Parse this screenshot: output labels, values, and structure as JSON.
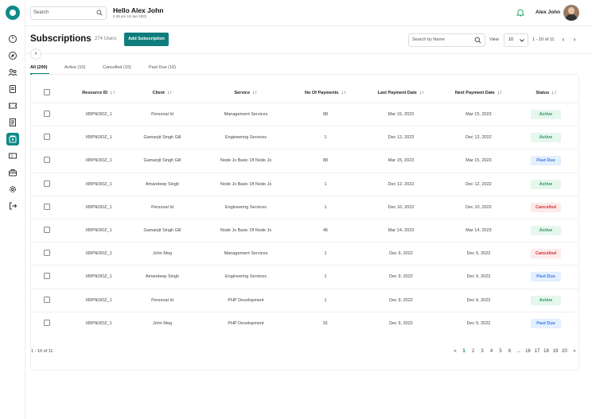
{
  "header": {
    "search_placeholder": "Search",
    "greeting": "Hello Alex John",
    "datetime": "4:45 pm 19 Jan 2022",
    "username": "Alex John"
  },
  "page": {
    "title": "Subscriptions",
    "user_count": "274 Users",
    "add_button": "Add Subscription",
    "search_placeholder": "Search by Name",
    "view_label": "View",
    "view_value": "10",
    "range": "1 - 10 of 11"
  },
  "tabs": [
    {
      "label": "All (200)"
    },
    {
      "label": "Active (10)"
    },
    {
      "label": "Cancelled (10)"
    },
    {
      "label": "Past Due (10)"
    }
  ],
  "columns": [
    "Resource ID",
    "Client",
    "Service",
    "No Of Payments",
    "Last Payment Date",
    "Next Payment Date",
    "Status"
  ],
  "rows": [
    {
      "id": "XBPNI3OZ_1",
      "client": "Personal Id",
      "service": "Management Services",
      "payments": "88",
      "last": "Mar 15, 2023",
      "next": "Mar 15, 2023",
      "status": "Active"
    },
    {
      "id": "XBPNI3OZ_1",
      "client": "Gamanjit Singh Gill",
      "service": "Engineering Services",
      "payments": "1",
      "last": "Dec 12, 2022",
      "next": "Dec 12, 2022",
      "status": "Active"
    },
    {
      "id": "XBPNI3OZ_1",
      "client": "Gamanjit Singh Gill",
      "service": "Node Js Basic Of Node Js",
      "payments": "88",
      "last": "Mar 15, 2023",
      "next": "Mar 15, 2023",
      "status": "Past Due"
    },
    {
      "id": "XBPNI3OZ_1",
      "client": "Amandeep Singh",
      "service": "Node Js Basic Of Node Js",
      "payments": "1",
      "last": "Dec 12, 2022",
      "next": "Dec 12, 2022",
      "status": "Active"
    },
    {
      "id": "XBPNI3OZ_1",
      "client": "Personal Id",
      "service": "Engineering Services",
      "payments": "1",
      "last": "Dec 10, 2022",
      "next": "Dec 10, 2022",
      "status": "Cancelled"
    },
    {
      "id": "XBPNI3OZ_1",
      "client": "Gamanjit Singh Gill",
      "service": "Node Js Basic Of Node Js",
      "payments": "46",
      "last": "Mar 14, 2023",
      "next": "Mar 14, 2023",
      "status": "Active"
    },
    {
      "id": "XBPNI3OZ_1",
      "client": "John Meg",
      "service": "Management Services",
      "payments": "1",
      "last": "Dec 9, 2022",
      "next": "Dec 9, 2022",
      "status": "Cancelled"
    },
    {
      "id": "XBPNI3OZ_1",
      "client": "Amandeep Singh",
      "service": "Engineering Services",
      "payments": "1",
      "last": "Dec 9, 2022",
      "next": "Dec 9, 2022",
      "status": "Past Due"
    },
    {
      "id": "XBPNI3OZ_1",
      "client": "Personal Id",
      "service": "PHP Development",
      "payments": "1",
      "last": "Dec 9, 2022",
      "next": "Dec 9, 2022",
      "status": "Active"
    },
    {
      "id": "XBPNI3OZ_1",
      "client": "John Meg",
      "service": "PHP Development",
      "payments": "91",
      "last": "Dec 9, 2022",
      "next": "Dec 9, 2022",
      "status": "Past Due"
    }
  ],
  "footer": {
    "range": "1 - 10 of 11",
    "pages": [
      "1",
      "2",
      "3",
      "4",
      "5",
      "6",
      "...",
      "16",
      "17",
      "18",
      "19",
      "20"
    ],
    "current_page": "1"
  },
  "colors": {
    "accent": "#0f7d7d",
    "active": "#1f9d55",
    "past_due": "#3c7ee8",
    "cancelled": "#d03232"
  },
  "icons": {
    "sidebar": [
      "dashboard-icon",
      "compass-icon",
      "users-icon",
      "document-icon",
      "ticket-icon",
      "invoice-icon",
      "subscriptions-icon",
      "coupon-icon",
      "briefcase-icon",
      "settings-icon",
      "logout-icon"
    ]
  }
}
